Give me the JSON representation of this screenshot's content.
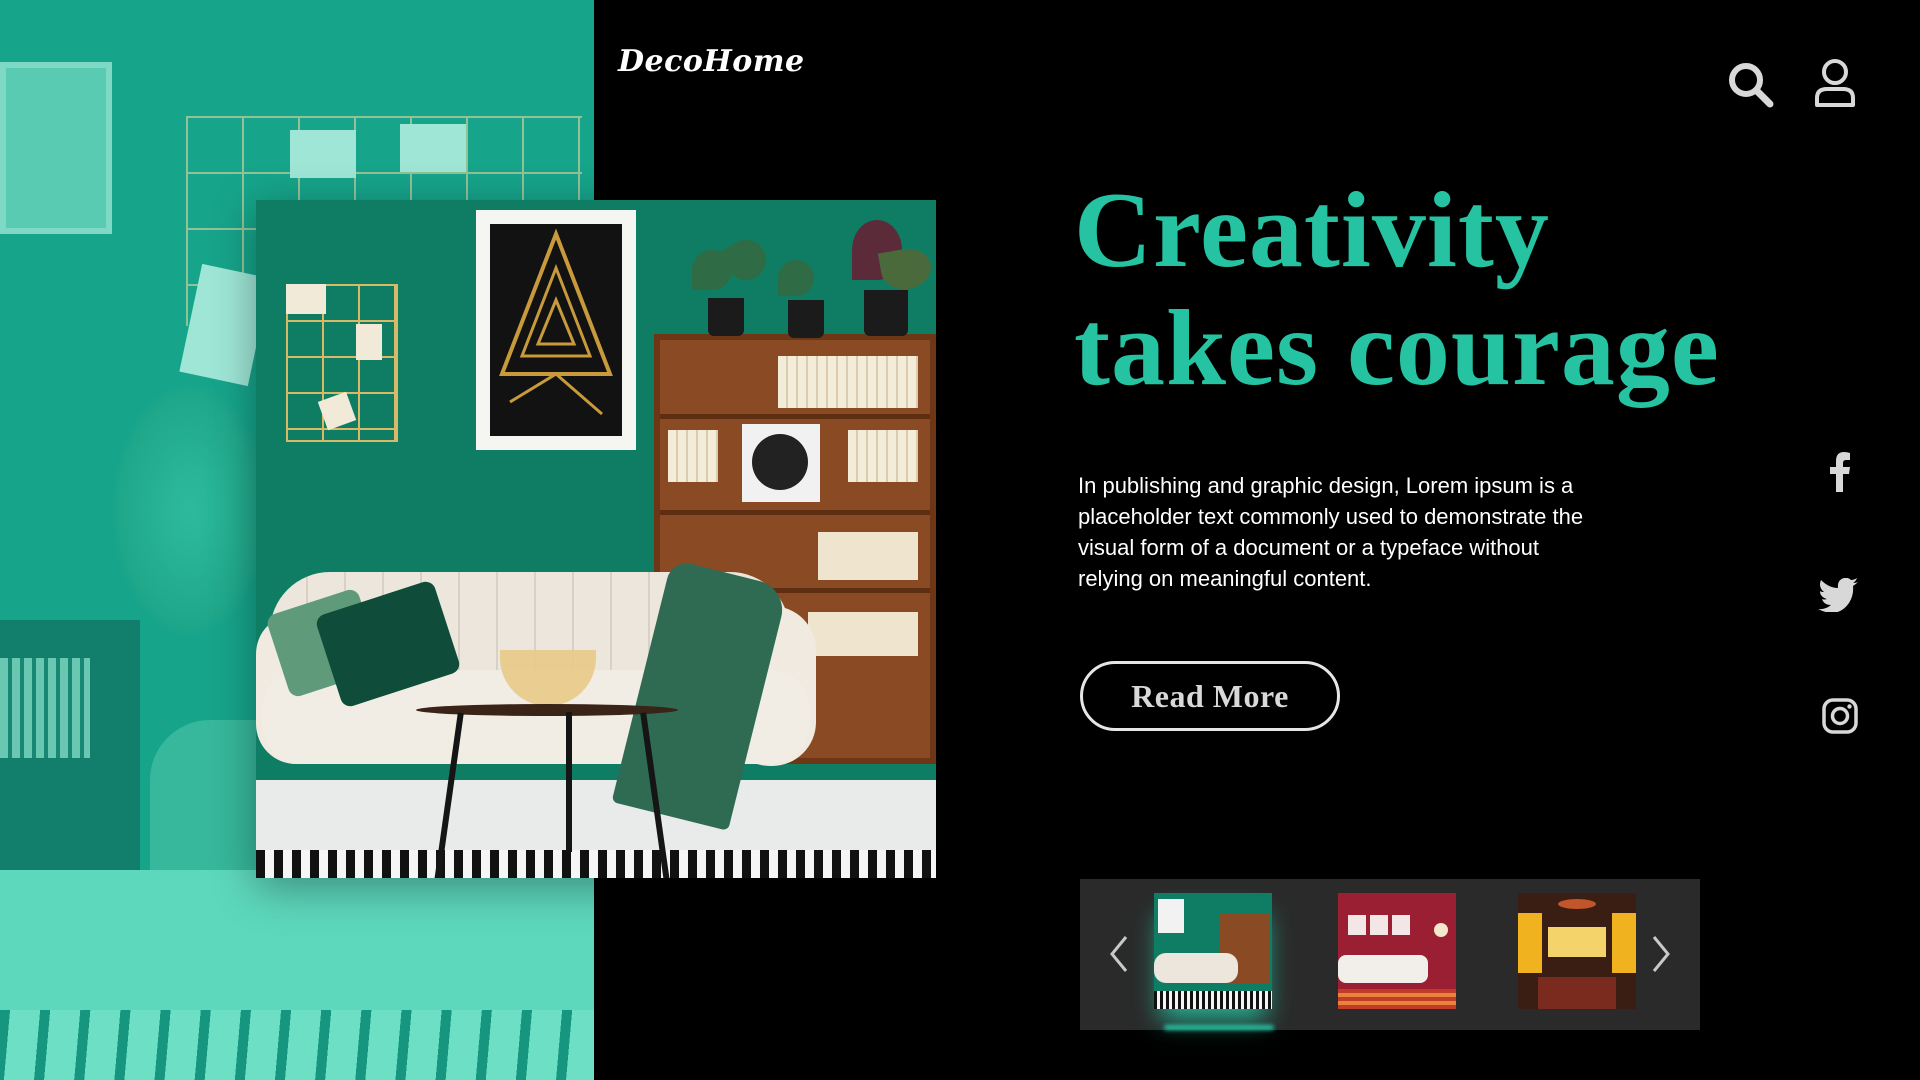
{
  "brand": {
    "name": "DecoHome",
    "accent_color": "#25c3a2",
    "panel_color": "#16a48a"
  },
  "header": {
    "icons": [
      "search-icon",
      "user-icon"
    ]
  },
  "hero": {
    "headline_line1": "Creativity",
    "headline_line2": "takes courage",
    "description": "In publishing and graphic design, Lorem ipsum is a placeholder text commonly used to demonstrate the visual form of a document or a typeface without relying on meaningful content.",
    "button_label": "Read More",
    "image": "living-room-green-wall-sofa"
  },
  "social": {
    "icons": [
      "facebook-icon",
      "twitter-icon",
      "instagram-icon"
    ]
  },
  "carousel": {
    "prev_icon": "chevron-left-icon",
    "next_icon": "chevron-right-icon",
    "thumbnails": [
      {
        "name": "green-living-room",
        "active": true
      },
      {
        "name": "red-living-room",
        "active": false
      },
      {
        "name": "yellow-restaurant",
        "active": false
      }
    ]
  }
}
